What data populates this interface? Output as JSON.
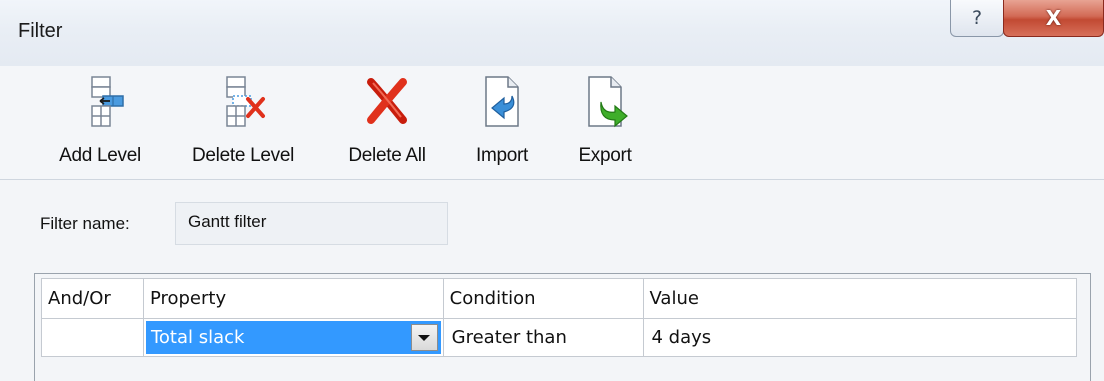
{
  "window": {
    "title": "Filter",
    "help_glyph": "?",
    "close_glyph": "X"
  },
  "toolbar": {
    "items": [
      {
        "label": "Add Level",
        "icon": "add-level-icon"
      },
      {
        "label": "Delete Level",
        "icon": "delete-level-icon"
      },
      {
        "label": "Delete All",
        "icon": "delete-all-icon"
      },
      {
        "label": "Import",
        "icon": "import-icon"
      },
      {
        "label": "Export",
        "icon": "export-icon"
      }
    ]
  },
  "filter_name": {
    "label": "Filter name:",
    "value": "Gantt filter"
  },
  "grid": {
    "headers": [
      "And/Or",
      "Property",
      "Condition",
      "Value"
    ],
    "rows": [
      {
        "and_or": "",
        "property": "Total slack",
        "condition": "Greater than",
        "value": "4 days"
      }
    ]
  },
  "colors": {
    "selection": "#3399ff",
    "close_button": "#c24a33",
    "accent_blue": "#3a8fd8",
    "accent_red": "#e0311c",
    "accent_green": "#3fae2a"
  }
}
